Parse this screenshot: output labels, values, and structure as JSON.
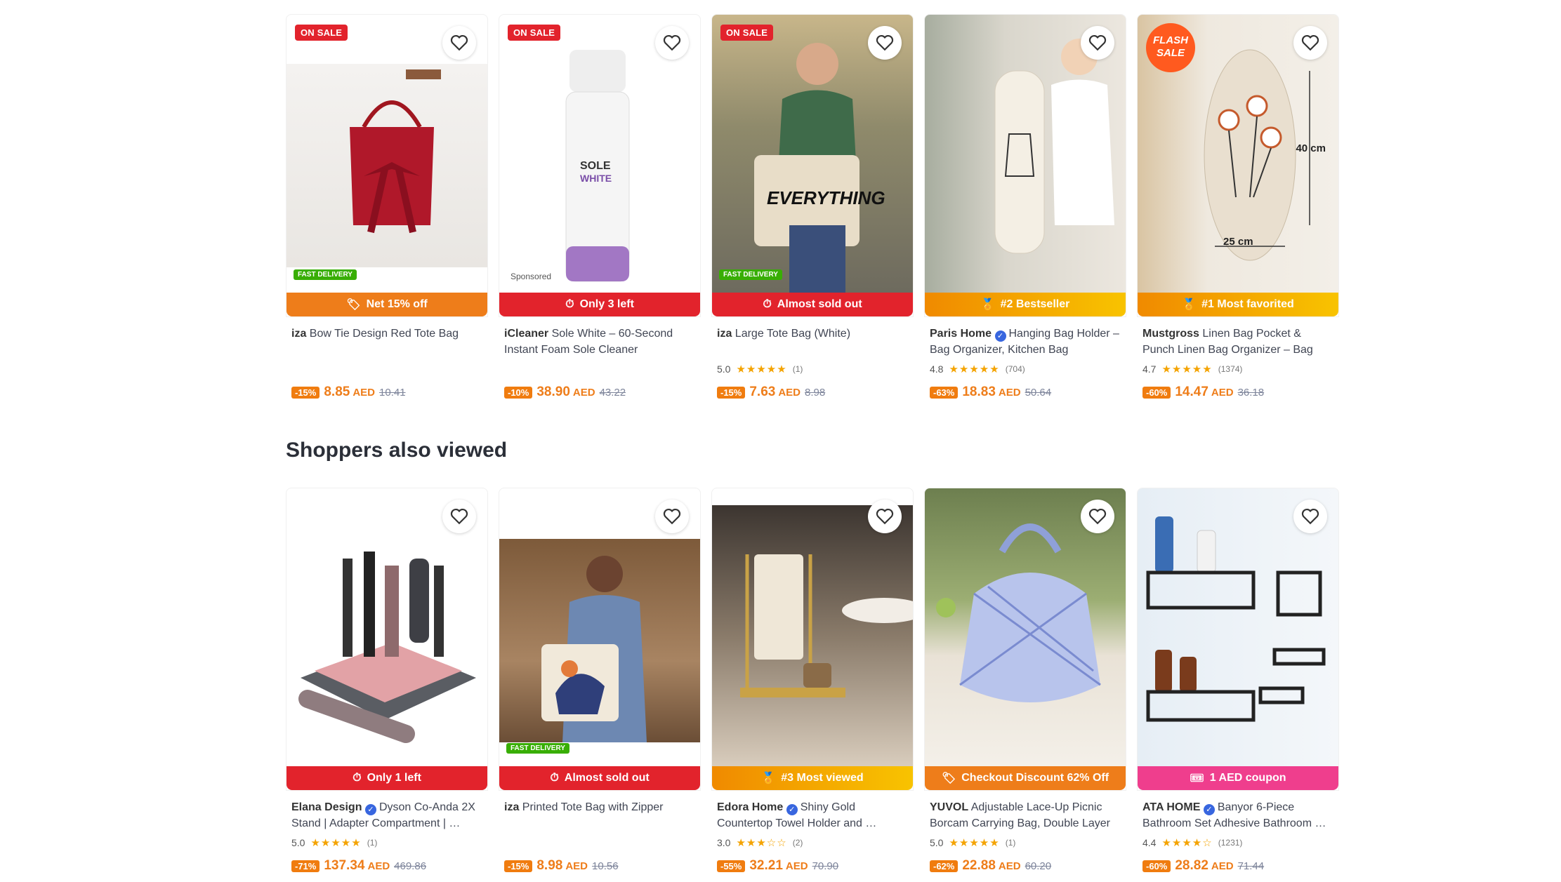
{
  "section_title": "Shoppers also viewed",
  "row1": [
    {
      "tag": "ON SALE",
      "badge": "FAST DELIVERY",
      "strip": "Net 15% off",
      "strip_style": "orange",
      "strip_icon": "tag-icon",
      "brand": "iza",
      "name": "Bow Tie Design Red Tote Bag",
      "rating": "",
      "reviews": "",
      "discount": "-15%",
      "price": "8.85",
      "currency": "AED",
      "old_price": "10.41"
    },
    {
      "tag": "ON SALE",
      "sponsored": "Sponsored",
      "strip": "Only 3 left",
      "strip_style": "red",
      "strip_icon": "clock-icon",
      "brand": "iCleaner",
      "name": "Sole White – 60-Second Instant Foam Sole Cleaner",
      "rating": "",
      "reviews": "",
      "discount": "-10%",
      "price": "38.90",
      "currency": "AED",
      "old_price": "43.22"
    },
    {
      "tag": "ON SALE",
      "badge": "FAST DELIVERY",
      "strip": "Almost sold out",
      "strip_style": "red",
      "strip_icon": "clock-icon",
      "brand": "iza",
      "name": "Large Tote Bag (White)",
      "rating": "5.0",
      "stars": "★★★★★",
      "reviews": "(1)",
      "discount": "-15%",
      "price": "7.63",
      "currency": "AED",
      "old_price": "8.98"
    },
    {
      "strip": "#2 Bestseller",
      "strip_style": "gold",
      "strip_icon": "medal-icon",
      "brand": "Paris Home",
      "verified": true,
      "name": "Hanging Bag Holder – Bag Organizer, Kitchen Bag Organiz…",
      "rating": "4.8",
      "stars": "★★★★★",
      "reviews": "(704)",
      "discount": "-63%",
      "price": "18.83",
      "currency": "AED",
      "old_price": "50.64"
    },
    {
      "flash": "FLASH SALE",
      "strip": "#1 Most favorited",
      "strip_style": "gold",
      "strip_icon": "medal-icon",
      "brand": "Mustgross",
      "name": "Linen Bag Pocket & Punch Linen Bag Organizer – Bag Organizer…",
      "rating": "4.7",
      "stars": "★★★★★",
      "reviews": "(1374)",
      "discount": "-60%",
      "price": "14.47",
      "currency": "AED",
      "old_price": "36.18",
      "dim_a": "40 cm",
      "dim_b": "25 cm"
    }
  ],
  "row2": [
    {
      "strip": "Only 1 left",
      "strip_style": "red",
      "strip_icon": "clock-icon",
      "brand": "Elana Design",
      "verified": true,
      "name": "Dyson Co-Anda 2X Stand | Adapter Compartment | …",
      "rating": "5.0",
      "stars": "★★★★★",
      "reviews": "(1)",
      "discount": "-71%",
      "price": "137.34",
      "currency": "AED",
      "old_price": "469.86"
    },
    {
      "badge": "FAST DELIVERY",
      "strip": "Almost sold out",
      "strip_style": "red",
      "strip_icon": "clock-icon",
      "brand": "iza",
      "name": "Printed Tote Bag with Zipper",
      "rating": "",
      "reviews": "",
      "discount": "-15%",
      "price": "8.98",
      "currency": "AED",
      "old_price": "10.56"
    },
    {
      "strip": "#3 Most viewed",
      "strip_style": "gold",
      "strip_icon": "medal-icon",
      "brand": "Edora Home",
      "verified": true,
      "name": "Shiny Gold Countertop Towel Holder and …",
      "rating": "3.0",
      "stars": "★★★☆☆",
      "reviews": "(2)",
      "discount": "-55%",
      "price": "32.21",
      "currency": "AED",
      "old_price": "70.90"
    },
    {
      "strip": "Checkout Discount 62% Off",
      "strip_style": "orange",
      "strip_icon": "tag-icon",
      "brand": "YUVOL",
      "name": "Adjustable Lace-Up Picnic Borcam Carrying Bag, Double Layer …",
      "rating": "5.0",
      "stars": "★★★★★",
      "reviews": "(1)",
      "discount": "-62%",
      "price": "22.88",
      "currency": "AED",
      "old_price": "60.20"
    },
    {
      "strip": "1 AED coupon",
      "strip_style": "pink",
      "strip_icon": "coupon-icon",
      "brand": "ATA HOME",
      "verified": true,
      "name": "Banyor 6-Piece Bathroom Set Adhesive Bathroom …",
      "rating": "4.4",
      "stars": "★★★★☆",
      "reviews": "(1231)",
      "discount": "-60%",
      "price": "28.82",
      "currency": "AED",
      "old_price": "71.44"
    }
  ],
  "palette": {
    "orange": "#ee7d1a",
    "red": "#e2232c",
    "gold": "#f8c300",
    "pink": "#ef3e8d",
    "green": "#38ae04"
  }
}
